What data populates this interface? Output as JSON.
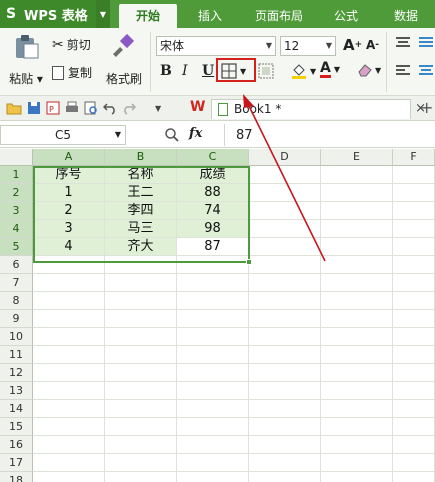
{
  "app": {
    "name": "WPS 表格"
  },
  "tabs": [
    {
      "label": "开始",
      "active": true
    },
    {
      "label": "插入"
    },
    {
      "label": "页面布局"
    },
    {
      "label": "公式"
    },
    {
      "label": "数据"
    }
  ],
  "ribbon": {
    "paste": "粘贴",
    "cut": "剪切",
    "copy": "复制",
    "format_painter": "格式刷",
    "font_name": "宋体",
    "font_size": "12",
    "bold": "B",
    "italic": "I",
    "underline": "U",
    "font_color_letter": "A"
  },
  "document": {
    "tab_label": "Book1 *"
  },
  "formula_bar": {
    "cell_ref": "C5",
    "fx": "fx",
    "value": "87"
  },
  "sheet": {
    "columns": [
      "A",
      "B",
      "C",
      "D",
      "E",
      "F"
    ],
    "rows": [
      "1",
      "2",
      "3",
      "4",
      "5",
      "6",
      "7",
      "8",
      "9",
      "10",
      "11",
      "12",
      "13",
      "14",
      "15",
      "16",
      "17",
      "18"
    ],
    "headers": [
      "序号",
      "名称",
      "成绩"
    ],
    "data": [
      [
        "1",
        "王二",
        "88"
      ],
      [
        "2",
        "李四",
        "74"
      ],
      [
        "3",
        "马三",
        "98"
      ],
      [
        "4",
        "齐大",
        "87"
      ]
    ]
  },
  "colors": {
    "accent": "#4f9b3a",
    "selection": "#4d9a3c",
    "highlight": "#d6201c",
    "arrow": "#c8161d"
  }
}
